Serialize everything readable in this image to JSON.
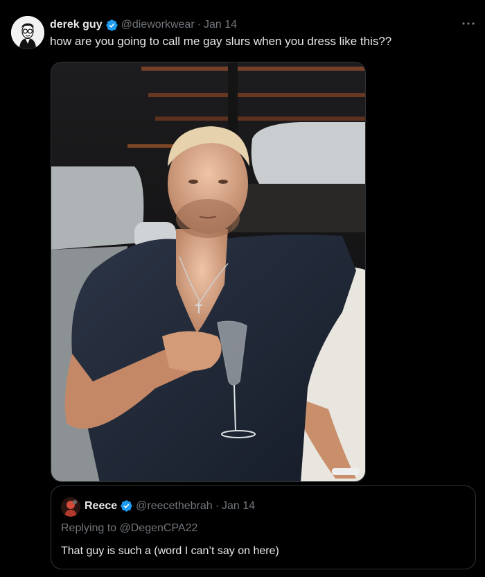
{
  "post": {
    "author_name": "derek guy",
    "author_handle": "@dieworkwear",
    "separator": "·",
    "date": "Jan 14",
    "text": "how are you going to call me gay slurs when you dress like this??",
    "more_icon": "more-horizontal-icon",
    "verified_icon": "verified-badge-icon",
    "photo_label": ""
  },
  "quote": {
    "author_name": "Reece",
    "author_handle": "@reecethebrah",
    "separator": "·",
    "date": "Jan 14",
    "replying_prefix": "Replying to ",
    "replying_to": "@DegenCPA22",
    "text": "That guy is such a (word I can’t say on here)"
  },
  "colors": {
    "background": "#000000",
    "text_primary": "#e7e9ea",
    "text_secondary": "#71767b",
    "verified_blue": "#1d9bf0",
    "border": "#2f3336"
  }
}
